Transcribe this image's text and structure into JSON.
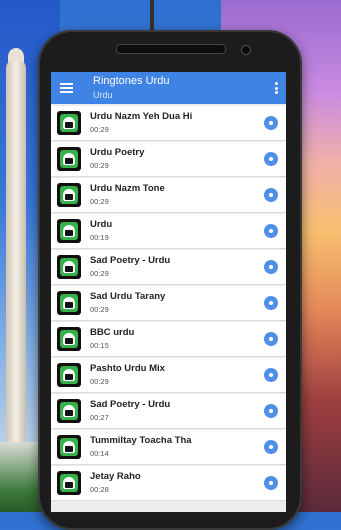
{
  "app": {
    "title": "Ringtones Urdu",
    "subtitle": "Urdu"
  },
  "icons": {
    "menu": "hamburger-menu-icon",
    "more": "more-vert-icon",
    "row_thumb": "green-phone-icon",
    "play": "play-circle-icon"
  },
  "colors": {
    "appbar": "#3f84e5",
    "play_button": "#4f8fe6",
    "thumb_green": "#36b24a"
  },
  "ringtones": [
    {
      "title": "Urdu Nazm Yeh Dua Hi",
      "duration": "00:29"
    },
    {
      "title": "Urdu Poetry",
      "duration": "00:29"
    },
    {
      "title": "Urdu Nazm Tone",
      "duration": "00:29"
    },
    {
      "title": "Urdu",
      "duration": "00:19"
    },
    {
      "title": "Sad Poetry - Urdu",
      "duration": "00:29"
    },
    {
      "title": "Sad Urdu Tarany",
      "duration": "00:29"
    },
    {
      "title": "BBC urdu",
      "duration": "00:15"
    },
    {
      "title": "Pashto Urdu Mix",
      "duration": "00:29"
    },
    {
      "title": "Sad Poetry - Urdu",
      "duration": "00:27"
    },
    {
      "title": "Tummiltay Toacha Tha",
      "duration": "00:14"
    },
    {
      "title": "Jetay Raho",
      "duration": "00:28"
    }
  ]
}
